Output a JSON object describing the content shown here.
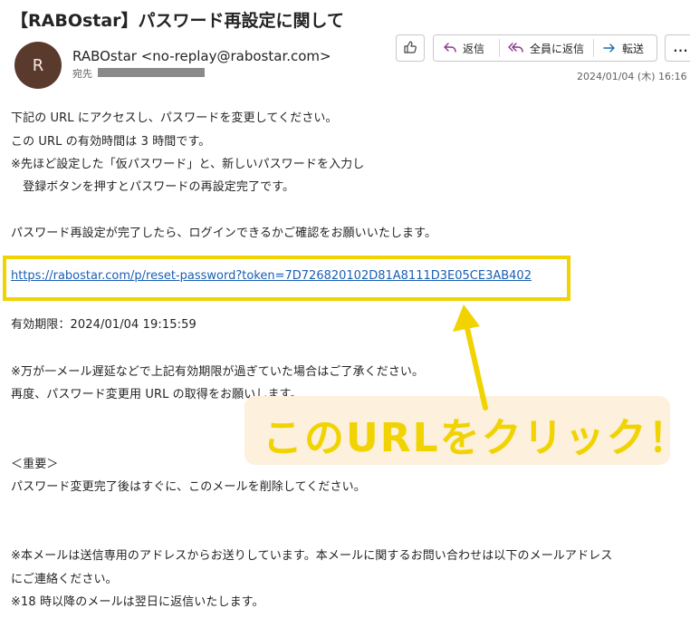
{
  "email": {
    "subject": "【RABOstar】パスワード再設定に関して",
    "avatar_initial": "R",
    "sender": "RABOstar <no-replay@rabostar.com>",
    "to_label": "宛先",
    "date": "2024/01/04 (木) 16:16"
  },
  "toolbar": {
    "reply_label": "返信",
    "reply_all_label": "全員に返信",
    "forward_label": "転送",
    "more_label": "..."
  },
  "body": {
    "line1": "下記の URL にアクセスし、パスワードを変更してください。",
    "line2": "この URL の有効時間は 3 時間です。",
    "line3": "※先ほど設定した「仮パスワード」と、新しいパスワードを入力し",
    "line4": "　登録ボタンを押すとパスワードの再設定完了です。",
    "line5": "パスワード再設定が完了したら、ログインできるかご確認をお願いいたします。",
    "link": "https://rabostar.com/p/reset-password?token=7D726820102D81A8111D3E05CE3AB402",
    "expiry": "有効期限：2024/01/04 19:15:59",
    "line6": "※万が一メール遅延などで上記有効期限が過ぎていた場合はご了承ください。",
    "line7": "再度、パスワード変更用 URL の取得をお願いします。",
    "line8": "＜重要＞",
    "line9": "パスワード変更完了後はすぐに、このメールを削除してください。",
    "line10": "※本メールは送信専用のアドレスからお送りしています。本メールに関するお問い合わせは以下のメールアドレス",
    "line11": "にご連絡ください。",
    "line12": "※18 時以降のメールは翌日に返信いたします。"
  },
  "annotation": {
    "callout": "このURLをクリック！",
    "highlight_color": "#f0d300",
    "callout_bg": "#fdf0dc"
  }
}
